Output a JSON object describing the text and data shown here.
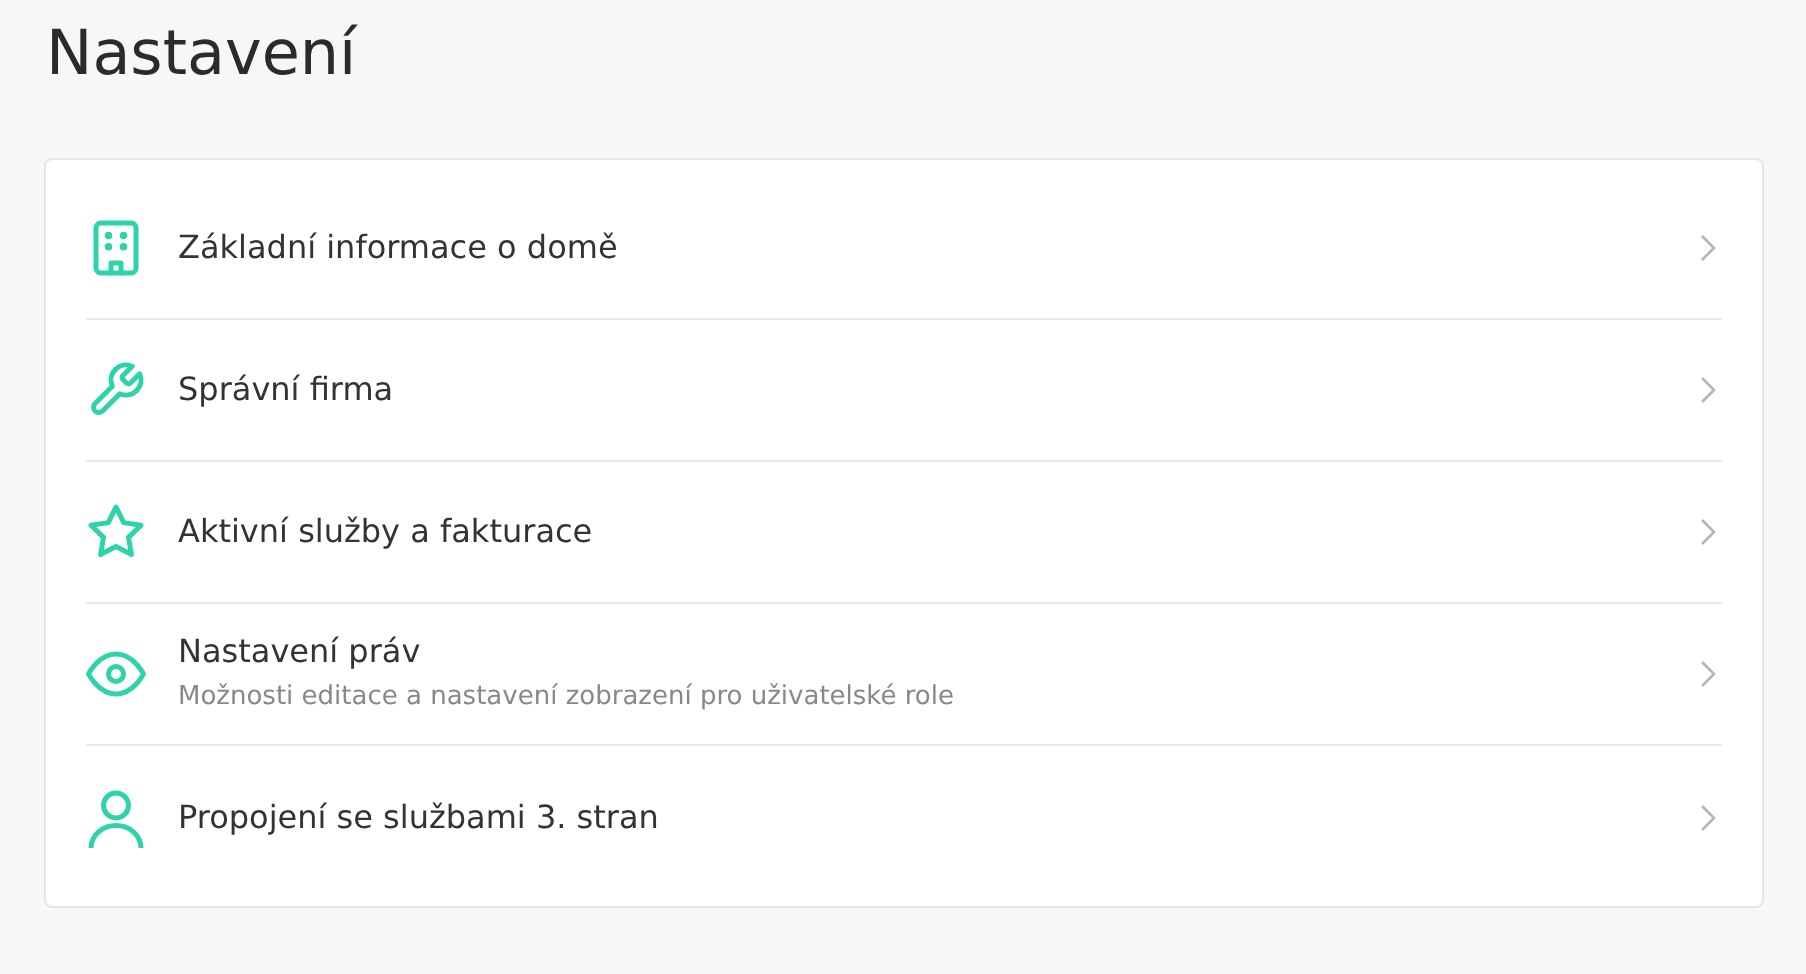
{
  "title": "Nastavení",
  "items": [
    {
      "kind": "building",
      "label": "Základní informace o domě"
    },
    {
      "kind": "wrench",
      "label": "Správní firma"
    },
    {
      "kind": "star",
      "label": "Aktivní služby a fakturace"
    },
    {
      "kind": "eye",
      "label": "Nastavení práv",
      "description": "Možnosti editace a nastavení zobrazení pro uživatelské role"
    },
    {
      "kind": "user",
      "label": "Propojení se službami 3. stran"
    }
  ]
}
